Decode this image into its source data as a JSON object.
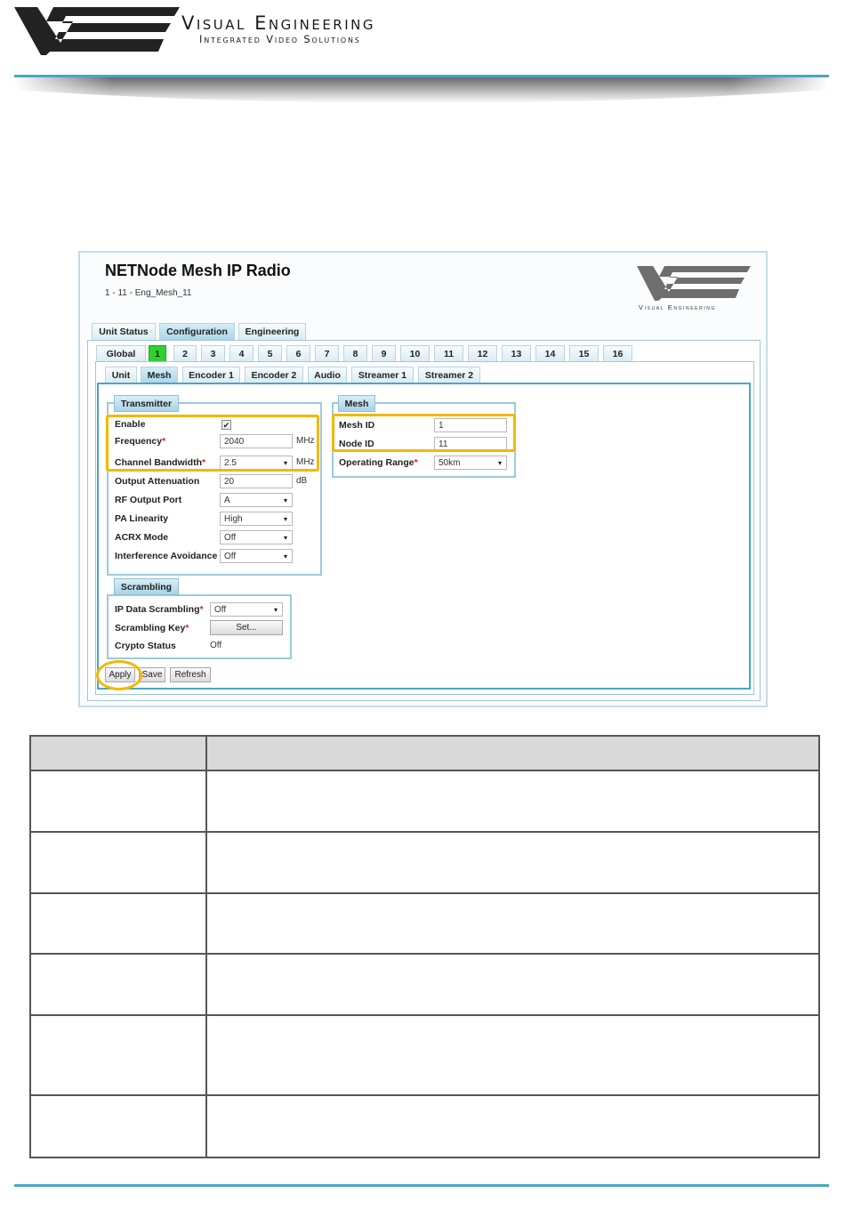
{
  "header": {
    "brand_name": "Visual Engineering",
    "brand_tagline": "Integrated Video Solutions"
  },
  "colors": {
    "accent_blue": "#4aa6c2",
    "highlight_yellow": "#f3b800",
    "active_green": "#2fd12f"
  },
  "app": {
    "title": "NETNode Mesh IP Radio",
    "subtitle": "1 - 11 - Eng_Mesh_11",
    "logo_text": "Visual Engineering"
  },
  "main_tabs": [
    {
      "label": "Unit Status"
    },
    {
      "label": "Configuration"
    },
    {
      "label": "Engineering"
    }
  ],
  "node_tabs": [
    {
      "label": "Global"
    },
    {
      "label": "1"
    },
    {
      "label": "2"
    },
    {
      "label": "3"
    },
    {
      "label": "4"
    },
    {
      "label": "5"
    },
    {
      "label": "6"
    },
    {
      "label": "7"
    },
    {
      "label": "8"
    },
    {
      "label": "9"
    },
    {
      "label": "10"
    },
    {
      "label": "11"
    },
    {
      "label": "12"
    },
    {
      "label": "13"
    },
    {
      "label": "14"
    },
    {
      "label": "15"
    },
    {
      "label": "16"
    }
  ],
  "sub_tabs": [
    {
      "label": "Unit"
    },
    {
      "label": "Mesh"
    },
    {
      "label": "Encoder 1"
    },
    {
      "label": "Encoder 2"
    },
    {
      "label": "Audio"
    },
    {
      "label": "Streamer 1"
    },
    {
      "label": "Streamer 2"
    }
  ],
  "transmitter": {
    "legend": "Transmitter",
    "enable_label": "Enable",
    "enable_checked": "✔",
    "frequency_label": "Frequency",
    "frequency_value": "2040",
    "frequency_unit": "MHz",
    "bandwidth_label": "Channel Bandwidth",
    "bandwidth_value": "2.5",
    "bandwidth_unit": "MHz",
    "attenuation_label": "Output Attenuation",
    "attenuation_value": "20",
    "attenuation_unit": "dB",
    "rf_port_label": "RF Output Port",
    "rf_port_value": "A",
    "pa_linearity_label": "PA Linearity",
    "pa_linearity_value": "High",
    "acrx_label": "ACRX Mode",
    "acrx_value": "Off",
    "interference_label": "Interference Avoidance",
    "interference_value": "Off"
  },
  "mesh": {
    "legend": "Mesh",
    "mesh_id_label": "Mesh ID",
    "mesh_id_value": "1",
    "node_id_label": "Node ID",
    "node_id_value": "11",
    "range_label": "Operating Range",
    "range_value": "50km"
  },
  "scrambling": {
    "legend": "Scrambling",
    "ip_label": "IP Data Scrambling",
    "ip_value": "Off",
    "key_label": "Scrambling Key",
    "key_button": "Set...",
    "crypto_label": "Crypto Status",
    "crypto_value": "Off"
  },
  "required_mark": "*",
  "buttons": {
    "apply": "Apply",
    "save": "Save",
    "refresh": "Refresh"
  },
  "caret": "▾"
}
